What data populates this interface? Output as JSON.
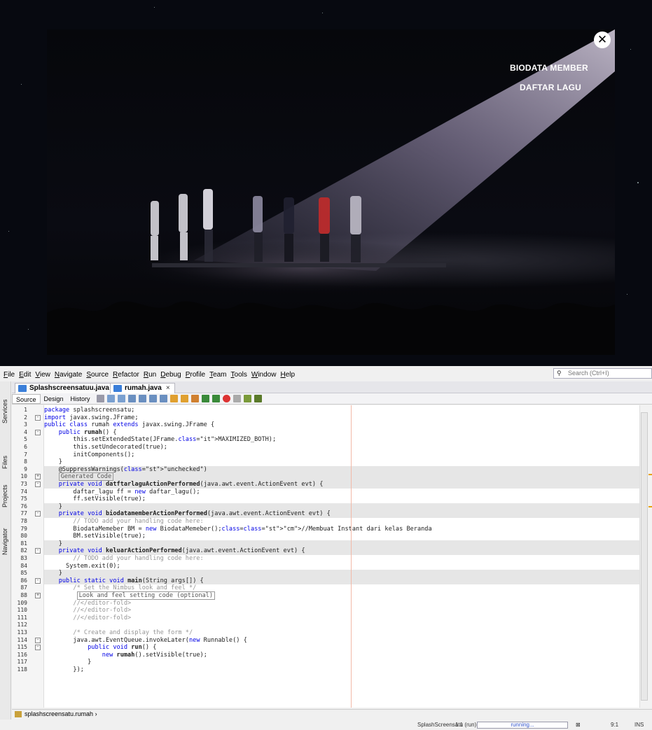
{
  "app": {
    "nav_links": [
      "BIODATA MEMBER",
      "DAFTAR LAGU"
    ],
    "close_icon": "close-icon"
  },
  "ide": {
    "menu": [
      "File",
      "Edit",
      "View",
      "Navigate",
      "Source",
      "Refactor",
      "Run",
      "Debug",
      "Profile",
      "Team",
      "Tools",
      "Window",
      "Help"
    ],
    "search_placeholder": "Search (Ctrl+I)",
    "side_tabs": [
      "Services",
      "Files",
      "Projects",
      "Navigator"
    ],
    "file_tabs": [
      {
        "label": "Splashscreensatuu.java",
        "close": "×"
      },
      {
        "label": "rumah.java",
        "close": "×"
      }
    ],
    "view_tabs": [
      "Source",
      "Design",
      "History"
    ],
    "line_numbers": [
      "1",
      "2",
      "3",
      "4",
      "5",
      "6",
      "7",
      "8",
      "9",
      "10",
      "73",
      "74",
      "75",
      "76",
      "77",
      "78",
      "79",
      "80",
      "81",
      "82",
      "83",
      "84",
      "85",
      "86",
      "87",
      "88",
      "109",
      "110",
      "111",
      "112",
      "113",
      "114",
      "115",
      "116",
      "117",
      "118"
    ],
    "code_lines": [
      "package splashscreensatu;",
      "import javax.swing.JFrame;",
      "public class rumah extends javax.swing.JFrame {",
      "    public rumah() {",
      "        this.setExtendedState(JFrame.MAXIMIZED_BOTH);",
      "        this.setUndecorated(true);",
      "        initComponents();",
      "    }",
      "    @SuppressWarnings(\"unchecked\")",
      "    Generated Code",
      "    private void datftarlaguActionPerformed(java.awt.event.ActionEvent evt) {",
      "        daftar_lagu ff = new daftar_lagu();",
      "        ff.setVisible(true);",
      "    }",
      "    private void biodatamemberActionPerformed(java.awt.event.ActionEvent evt) {",
      "        // TODO add your handling code here:",
      "        BiodataMemeber BM = new BiodataMemeber();//Membuat Instant dari kelas Beranda",
      "        BM.setVisible(true);",
      "    }",
      "    private void keluarActionPerformed(java.awt.event.ActionEvent evt) {",
      "        // TODO add your handling code here:",
      "      System.exit(0);",
      "    }",
      "    public static void main(String args[]) {",
      "        /* Set the Nimbus look and feel */",
      "         Look and feel setting code (optional)",
      "        //</editor-fold>",
      "        //</editor-fold>",
      "        //</editor-fold>",
      "",
      "        /* Create and display the form */",
      "        java.awt.EventQueue.invokeLater(new Runnable() {",
      "            public void run() {",
      "                new rumah().setVisible(true);",
      "            }",
      "        });"
    ],
    "breadcrumb": "splashscreensatu.rumah",
    "status": {
      "project": "SplashScreensatu",
      "position": "1 1 (run)",
      "progress": "running...",
      "cursor": "9:1",
      "mode": "INS"
    }
  }
}
